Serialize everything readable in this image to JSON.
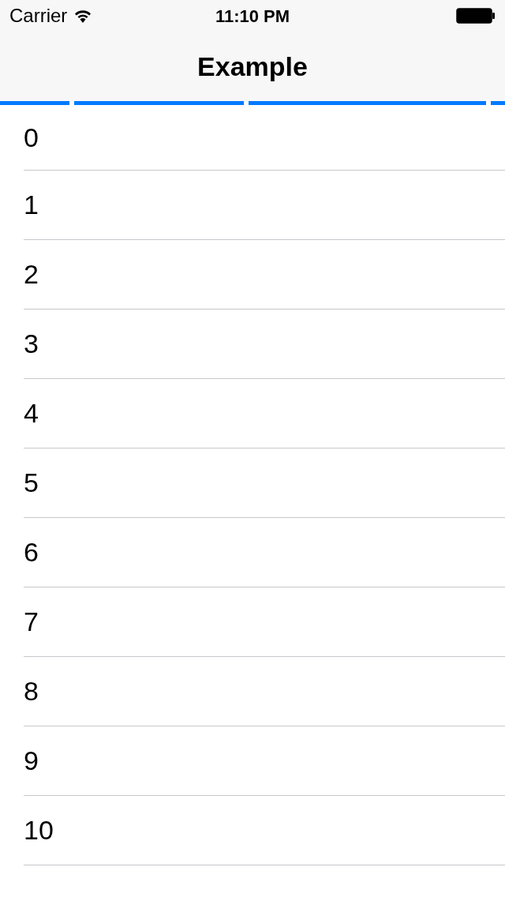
{
  "status_bar": {
    "carrier": "Carrier",
    "time": "11:10 PM"
  },
  "nav_bar": {
    "title": "Example"
  },
  "rows": [
    "0",
    "1",
    "2",
    "3",
    "4",
    "5",
    "6",
    "7",
    "8",
    "9",
    "10"
  ]
}
